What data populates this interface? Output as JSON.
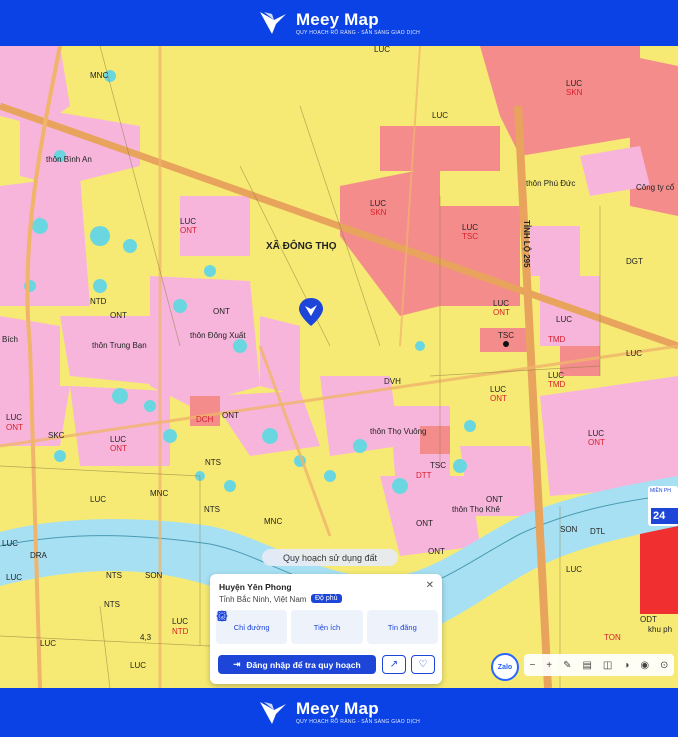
{
  "brand": {
    "name": "Meey Map",
    "tagline": "QUY HOẠCH RÕ RÀNG - SẴN SÀNG GIAO DỊCH"
  },
  "map": {
    "commune_label": "XÃ ĐÔNG THỌ",
    "road_label": "TỈNH LỘ 295",
    "colors": {
      "agri": "#f6ea74",
      "rural_res": "#f7b5dc",
      "industrial": "#f48c8c",
      "water": "#6ad7e0",
      "river": "#a7e0f3",
      "road": "#e8a45c",
      "transport": "#f0b46a"
    },
    "labels": [
      {
        "t": "LUC",
        "c": "dark"
      },
      {
        "t": "LUC",
        "c": "dark"
      },
      {
        "t": "LUC",
        "c": "dark"
      },
      {
        "t": "SKN",
        "c": "red"
      },
      {
        "t": "MNC",
        "c": "dark"
      },
      {
        "t": "LUC",
        "c": "dark"
      },
      {
        "t": "ONT",
        "c": "red"
      },
      {
        "t": "LUC",
        "c": "dark"
      },
      {
        "t": "SKN",
        "c": "red"
      },
      {
        "t": "LUC",
        "c": "dark"
      },
      {
        "t": "TSC",
        "c": "red"
      },
      {
        "t": "LUC",
        "c": "dark"
      },
      {
        "t": "ONT",
        "c": "red"
      },
      {
        "t": "LUC",
        "c": "dark"
      },
      {
        "t": "TMD",
        "c": "red"
      },
      {
        "t": "TSC",
        "c": "dark"
      },
      {
        "t": "ONT",
        "c": "dark"
      },
      {
        "t": "ONT",
        "c": "dark"
      },
      {
        "t": "LUC",
        "c": "dark"
      },
      {
        "t": "ONT",
        "c": "red"
      },
      {
        "t": "LUC",
        "c": "dark"
      },
      {
        "t": "TMD",
        "c": "red"
      },
      {
        "t": "LUC",
        "c": "dark"
      },
      {
        "t": "ONT",
        "c": "red"
      },
      {
        "t": "LUC",
        "c": "dark"
      },
      {
        "t": "ONT",
        "c": "red"
      },
      {
        "t": "NTS",
        "c": "dark"
      },
      {
        "t": "ONT",
        "c": "dark"
      },
      {
        "t": "DTT",
        "c": "red"
      },
      {
        "t": "ONT",
        "c": "dark"
      },
      {
        "t": "ONT",
        "c": "dark"
      },
      {
        "t": "LUC",
        "c": "dark"
      },
      {
        "t": "NTS",
        "c": "dark"
      },
      {
        "t": "LUC",
        "c": "dark"
      },
      {
        "t": "DRA",
        "c": "dark"
      },
      {
        "t": "NTS",
        "c": "dark"
      },
      {
        "t": "SON",
        "c": "dark"
      },
      {
        "t": "LUC",
        "c": "dark"
      },
      {
        "t": "NTD",
        "c": "red"
      },
      {
        "t": "LUC",
        "c": "dark"
      },
      {
        "t": "DTL",
        "c": "dark"
      },
      {
        "t": "DGT",
        "c": "dark"
      },
      {
        "t": "LUC",
        "c": "dark"
      },
      {
        "t": "TON",
        "c": "red"
      },
      {
        "t": "ODT",
        "c": "dark"
      },
      {
        "t": "thôn Bình An",
        "c": "dark"
      },
      {
        "t": "thôn Trung Bạn",
        "c": "dark"
      },
      {
        "t": "thôn Đông Xuất",
        "c": "dark"
      },
      {
        "t": "thôn Thọ Vuông",
        "c": "dark"
      },
      {
        "t": "thôn Thọ Khê",
        "c": "dark"
      },
      {
        "t": "thôn Phú Đức",
        "c": "dark"
      },
      {
        "t": "Công ty cổ",
        "c": "dark"
      },
      {
        "t": "LUC",
        "c": "dark"
      },
      {
        "t": "SKC",
        "c": "dark"
      },
      {
        "t": "Bích",
        "c": "dark"
      },
      {
        "t": "LUC",
        "c": "dark"
      },
      {
        "t": "ONT",
        "c": "red"
      },
      {
        "t": "NTS",
        "c": "dark"
      },
      {
        "t": "MNC",
        "c": "dark"
      },
      {
        "t": "LUC",
        "c": "dark"
      },
      {
        "t": "SON",
        "c": "dark"
      },
      {
        "t": "LUC",
        "c": "dark"
      },
      {
        "t": "ONT",
        "c": "dark"
      },
      {
        "t": "DCH",
        "c": "red"
      },
      {
        "t": "TSC",
        "c": "dark"
      },
      {
        "t": "DVH",
        "c": "dark"
      },
      {
        "t": "NTD",
        "c": "dark"
      },
      {
        "t": "4,3",
        "c": "dark"
      },
      {
        "t": "MNC",
        "c": "dark"
      },
      {
        "t": "khu ph",
        "c": "dark"
      }
    ]
  },
  "pill": "Quy hoạch sử dụng đất",
  "card": {
    "title": "Huyện Yên Phong",
    "subtitle": "Tỉnh Bắc Ninh, Việt Nam",
    "badge": "Độ phủ",
    "actions": [
      {
        "label": "Chỉ đường",
        "icon": "direction-icon"
      },
      {
        "label": "Tiện ích",
        "icon": "utility-icon"
      },
      {
        "label": "Tin đăng",
        "icon": "listing-icon"
      }
    ],
    "login": "Đăng nhập để tra quy hoạch"
  },
  "zalo": "Zalo",
  "side_panel": {
    "label": "MIỀN PH",
    "number": "24"
  }
}
